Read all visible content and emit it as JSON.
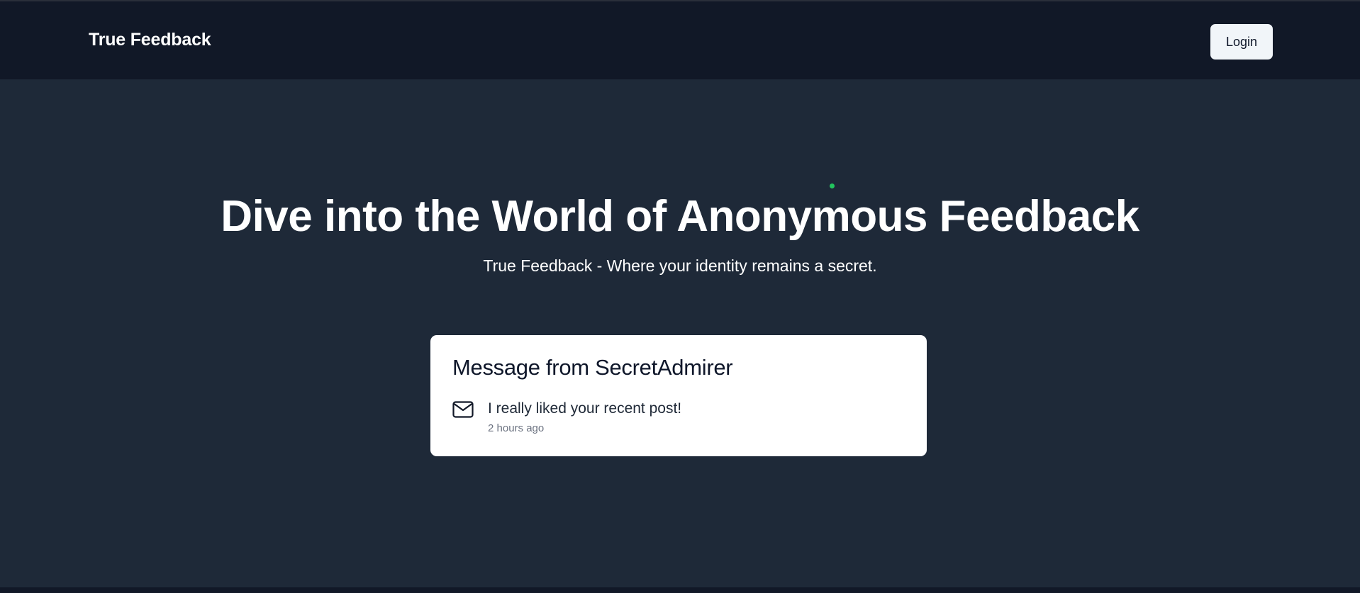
{
  "navbar": {
    "brand": "True Feedback",
    "login_label": "Login"
  },
  "hero": {
    "title": "Dive into the World of Anonymous Feedback",
    "subtitle": "True Feedback - Where your identity remains a secret."
  },
  "message_card": {
    "title": "Message from SecretAdmirer",
    "icon": "mail-icon",
    "message": "I really liked your recent post!",
    "time": "2 hours ago"
  },
  "colors": {
    "navbar_bg": "#111827",
    "hero_bg": "#1e2938",
    "card_bg": "#ffffff",
    "button_bg": "#f1f5f9",
    "indicator": "#22c55e"
  }
}
